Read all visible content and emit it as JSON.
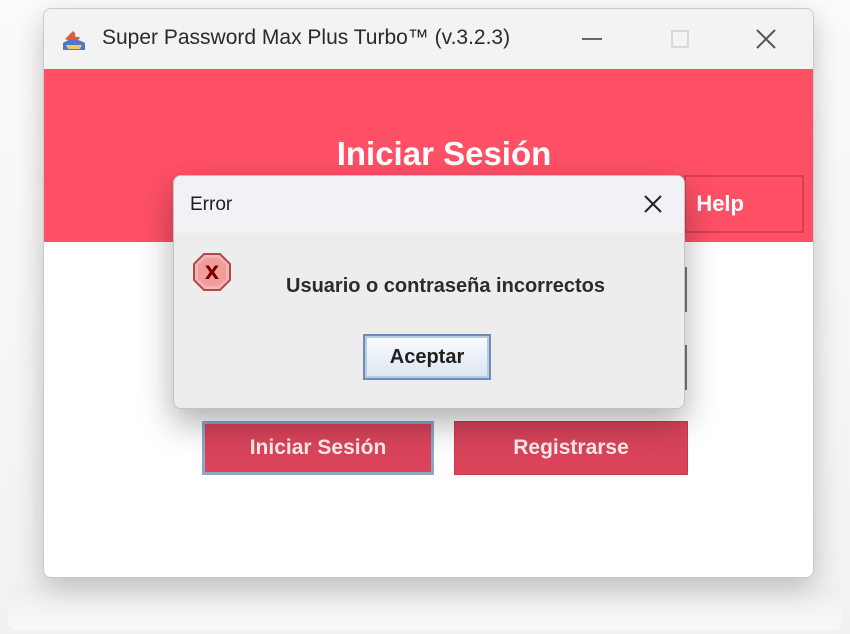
{
  "window": {
    "title": "Super Password Max Plus Turbo™ (v.3.2.3)",
    "header_title": "Iniciar Sesión",
    "help_label": "Help",
    "login_label": "Iniciar Sesión",
    "register_label": "Registrarse",
    "controls": {
      "minimize_icon": "minimize-icon",
      "maximize_icon": "maximize-icon",
      "close_icon": "close-icon"
    },
    "app_icon": "java-cup-icon"
  },
  "dialog": {
    "title": "Error",
    "message": "Usuario o contraseña incorrectos",
    "accept_label": "Aceptar",
    "icon": "error-icon",
    "icon_glyph": "X",
    "close_icon": "close-icon"
  },
  "colors": {
    "header_red": "#ff5066",
    "button_red": "#d9445a",
    "focus_blue": "#8ba8c9"
  }
}
